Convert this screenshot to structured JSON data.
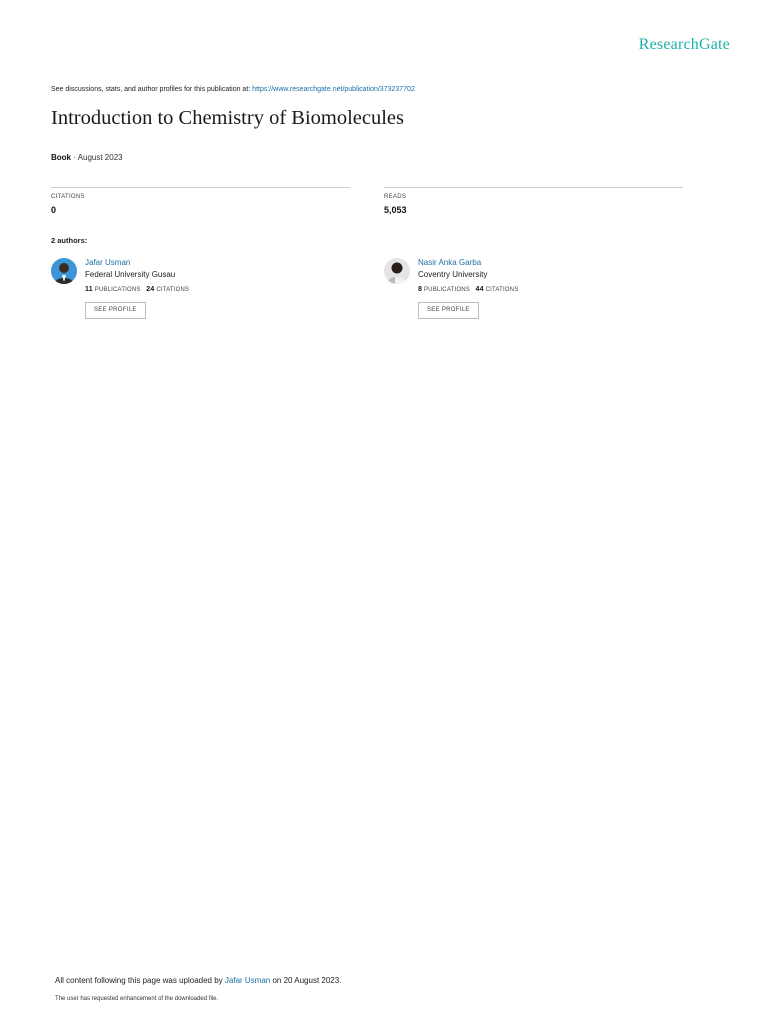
{
  "header": {
    "logo_text": "ResearchGate",
    "discussion_prefix": "See discussions, stats, and author profiles for this publication at: ",
    "publication_url": "https://www.researchgate.net/publication/373237702"
  },
  "publication": {
    "title": "Introduction to Chemistry of Biomolecules",
    "type": "Book",
    "date_sep": " · ",
    "date": "August 2023"
  },
  "stats": {
    "citations_label": "CITATIONS",
    "citations_value": "0",
    "reads_label": "READS",
    "reads_value": "5,053"
  },
  "authors_heading": "2 authors:",
  "authors": [
    {
      "name": "Jafar Usman",
      "institution": "Federal University Gusau",
      "publications": "11",
      "publications_label": "PUBLICATIONS",
      "citations": "24",
      "citations_label": "CITATIONS",
      "button": "SEE PROFILE"
    },
    {
      "name": "Nasir Anka Garba",
      "institution": "Coventry University",
      "publications": "8",
      "publications_label": "PUBLICATIONS",
      "citations": "44",
      "citations_label": "CITATIONS",
      "button": "SEE PROFILE"
    }
  ],
  "footer": {
    "uploaded_prefix": "All content following this page was uploaded by ",
    "uploader": "Jafar Usman",
    "uploaded_suffix": " on 20 August 2023.",
    "note": "The user has requested enhancement of the downloaded file."
  },
  "colors": {
    "logo": "#19b3a8",
    "link": "#1b6fa8"
  }
}
